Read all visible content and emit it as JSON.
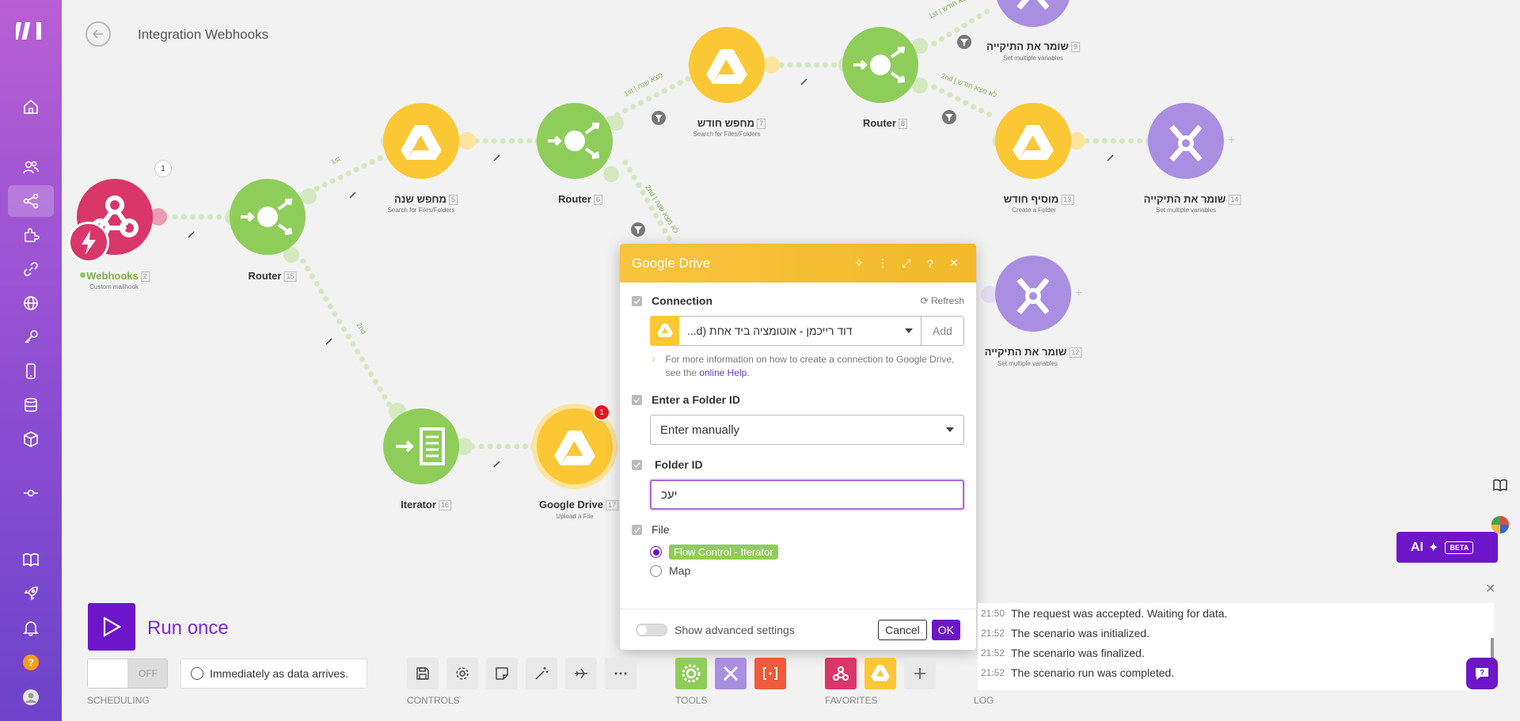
{
  "header": {
    "title": "Integration Webhooks"
  },
  "sidebar": {
    "items": [
      "home",
      "team",
      "scenarios",
      "apps",
      "connections",
      "webhooks",
      "keys",
      "devices",
      "data-stores",
      "data-structures",
      "flow",
      "docs",
      "whats-new",
      "notifications",
      "help",
      "profile"
    ]
  },
  "nodes": [
    {
      "id": "webhooks",
      "label": "Webhooks",
      "num": "2",
      "sub": "Custom mailhook",
      "badge": "1"
    },
    {
      "id": "router15",
      "label": "Router",
      "num": "15",
      "sub": ""
    },
    {
      "id": "search-year",
      "label": "מחפש שנה",
      "num": "5",
      "sub": "Search for Files/Folders"
    },
    {
      "id": "router6",
      "label": "Router",
      "num": "6",
      "sub": ""
    },
    {
      "id": "search-month",
      "label": "מחפש חודש",
      "num": "7",
      "sub": "Search for Files/Folders"
    },
    {
      "id": "router8",
      "label": "Router",
      "num": "8",
      "sub": ""
    },
    {
      "id": "keeper9",
      "label": "שומר את התיקייה",
      "num": "9",
      "sub": "Set multiple variables"
    },
    {
      "id": "add-month",
      "label": "מוסיף חודש",
      "num": "13",
      "sub": "Create a Folder"
    },
    {
      "id": "keeper14",
      "label": "שומר את התיקייה",
      "num": "14",
      "sub": "Set multiple variables"
    },
    {
      "id": "keeper12",
      "label": "שומר את התיקייה",
      "num": "12",
      "sub": "Set multiple variables"
    },
    {
      "id": "iterator",
      "label": "Iterator",
      "num": "16",
      "sub": ""
    },
    {
      "id": "gdrive",
      "label": "Google Drive",
      "num": "17",
      "sub": "Upload a File",
      "badge": "1"
    }
  ],
  "route_labels": {
    "r15_1st": "1st",
    "r15_2nd": "2nd",
    "r6_1st": "1st | מצא שנה",
    "r6_2nd": "2nd | לא מצא שנה",
    "r8_1st": "1st | מצא חודש",
    "r8_2nd": "2nd | לא מצא חודש"
  },
  "dialog": {
    "title": "Google Drive",
    "connection_label": "Connection",
    "refresh": "Refresh",
    "connection_value": "דוד רייכמן - אוטומציה ביד אחת (d...",
    "add": "Add",
    "hint_prefix": "For more information on how to create a connection to Google Drive, see the",
    "hint_link": "online Help.",
    "folder_mode_label": "Enter a Folder ID",
    "folder_mode_value": "Enter manually",
    "folder_id_label": "Folder ID",
    "folder_id_value": "יעכ",
    "file_label": "File",
    "file_option1": "Flow Control - Iterator",
    "file_option2": "Map",
    "advanced": "Show advanced settings",
    "cancel": "Cancel",
    "ok": "OK"
  },
  "bottom": {
    "run_once": "Run once",
    "toggle_off": "OFF",
    "schedule": "Immediately as data arrives.",
    "scheduling_label": "SCHEDULING",
    "controls_label": "CONTROLS",
    "tools_label": "TOOLS",
    "favorites_label": "FAVORITES",
    "log_label": "LOG"
  },
  "log": [
    {
      "time": "21:50",
      "text": "The request was accepted. Waiting for data."
    },
    {
      "time": "21:52",
      "text": "The scenario was initialized."
    },
    {
      "time": "21:52",
      "text": "The scenario was finalized."
    },
    {
      "time": "21:52",
      "text": "The scenario run was completed."
    }
  ],
  "ai": {
    "label": "AI",
    "beta": "BETA"
  },
  "colors": {
    "accent": "#6d16c9",
    "router": "#8fcd5a",
    "drive": "#fcc734",
    "tools": "#a98ee2",
    "webhook": "#d9366a"
  }
}
